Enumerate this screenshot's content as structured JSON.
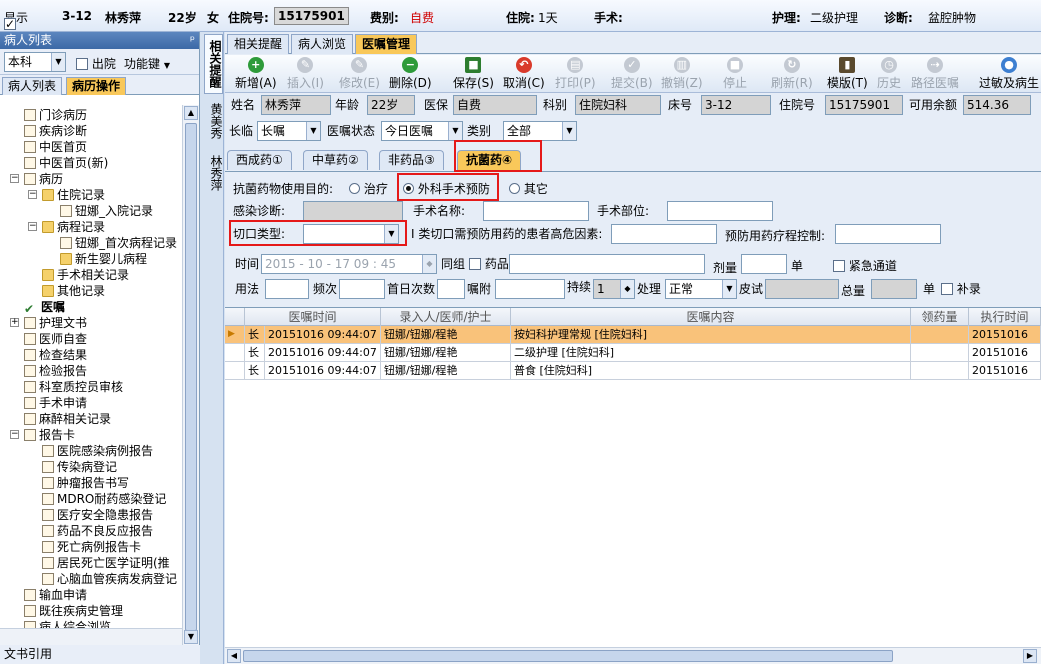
{
  "top": {
    "show_label": "显示",
    "bed": "3-12",
    "name": "林秀萍",
    "age": "22岁",
    "sex": "女",
    "inpatient_no_label": "住院号:",
    "inpatient_no": "15175901",
    "fee_type_label": "费别:",
    "fee_type": "自费",
    "stay_label": "住院:",
    "stay": "1天",
    "surgery_label": "手术:",
    "nursing_label": "护理:",
    "nursing": "二级护理",
    "diagnosis_label": "诊断:",
    "diagnosis": "盆腔肿物"
  },
  "left": {
    "title": "病人列表",
    "pin": "ᵖ",
    "dept": "本科",
    "discharge_label": "出院",
    "function_key": "功能键",
    "tabs": [
      "病人列表",
      "病历操作"
    ],
    "tree": [
      "门诊病历",
      "疾病诊断",
      "中医首页",
      "中医首页(新)",
      "病历",
      "住院记录",
      "钮娜_入院记录",
      "病程记录",
      "钮娜_首次病程记录",
      "新生婴儿病程",
      "手术相关记录",
      "其他记录",
      "医嘱",
      "护理文书",
      "医师自查",
      "检查结果",
      "检验报告",
      "科室质控员审核",
      "手术申请",
      "麻醉相关记录",
      "报告卡",
      "医院感染病例报告",
      "传染病登记",
      "肿瘤报告书写",
      "MDRO耐药感染登记",
      "医疗安全隐患报告",
      "药品不良反应报告",
      "死亡病例报告卡",
      "居民死亡医学证明(推",
      "心脑血管疾病发病登记",
      "输血申请",
      "既往疾病史管理",
      "病人综合浏览"
    ],
    "footer": "文书引用"
  },
  "side_tabs": [
    "相关提醒",
    "黄美秀",
    "林秀萍"
  ],
  "main": {
    "tabs": [
      "相关提醒",
      "病人浏览",
      "医嘱管理"
    ],
    "toolbar": [
      "新增(A)",
      "插入(I)",
      "修改(E)",
      "删除(D)",
      "保存(S)",
      "取消(C)",
      "打印(P)",
      "提交(B)",
      "撤销(Z)",
      "停止",
      "刷新(R)",
      "模版(T)",
      "历史",
      "路径医嘱",
      "过敏及病生"
    ],
    "info": {
      "name_label": "姓名",
      "name": "林秀萍",
      "age_label": "年龄",
      "age": "22岁",
      "insurance_label": "医保",
      "insurance": "自费",
      "dept_label": "科别",
      "dept": "住院妇科",
      "bed_label": "床号",
      "bed": "3-12",
      "inpatient_label": "住院号",
      "inpatient": "15175901",
      "balance_label": "可用余额",
      "balance": "514.36"
    },
    "filter": {
      "term_label": "长临",
      "term": "长嘱",
      "status_label": "医嘱状态",
      "status": "今日医嘱",
      "category_label": "类别",
      "category": "全部"
    },
    "subtabs": [
      "西成药①",
      "中草药②",
      "非药品③",
      "抗菌药④"
    ],
    "antibiotic": {
      "purpose_label": "抗菌药物使用目的:",
      "opt_treat": "治疗",
      "opt_surgery": "外科手术预防",
      "opt_other": "其它",
      "infection_label": "感染诊断:",
      "op_name_label": "手术名称:",
      "op_site_label": "手术部位:",
      "incision_label": "切口类型:",
      "risk_label": "I 类切口需预防用药的患者高危因素:",
      "course_label": "预防用药疗程控制:"
    },
    "order": {
      "time_label": "时间",
      "time": "2015 - 10 - 17   09 : 45",
      "group_label": "同组",
      "drug_label": "药品",
      "dose_label": "剂量",
      "unit_label": "单",
      "urgent_label": "紧急通道",
      "usage_label": "用法",
      "freq_label": "频次",
      "firstday_label": "首日次数",
      "note_label": "嘱附",
      "duration_label": "持续",
      "duration": "1",
      "process_label": "处理",
      "process": "正常",
      "skin_label": "皮试",
      "total_label": "总量",
      "unit2_label": "单",
      "supp_label": "补录"
    },
    "grid": {
      "columns": [
        "医嘱时间",
        "录入人/医师/护士",
        "医嘱内容",
        "领药量",
        "执行时间"
      ],
      "rows": [
        {
          "type": "长",
          "time": "20151016 09:44:07",
          "staff": "钮娜/钮娜/程艳",
          "content": "按妇科护理常规  [住院妇科]",
          "exec": "20151016"
        },
        {
          "type": "长",
          "time": "20151016 09:44:07",
          "staff": "钮娜/钮娜/程艳",
          "content": "二级护理   [住院妇科]",
          "exec": "20151016"
        },
        {
          "type": "长",
          "time": "20151016 09:44:07",
          "staff": "钮娜/钮娜/程艳",
          "content": "普食   [住院妇科]",
          "exec": "20151016"
        }
      ]
    }
  }
}
